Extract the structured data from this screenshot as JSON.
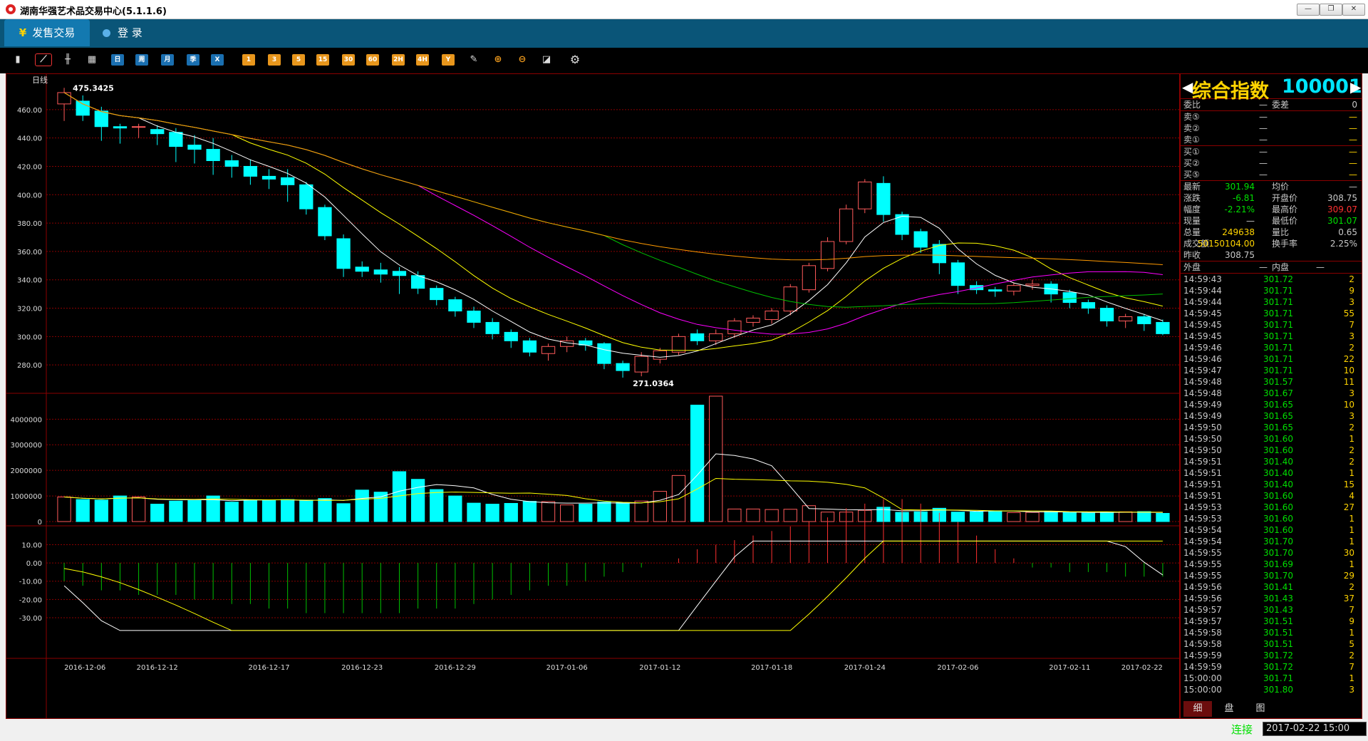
{
  "window": {
    "title": "湖南华强艺术品交易中心(5.1.1.6)",
    "buttons": {
      "minimize": "—",
      "restore": "❐",
      "close": "✕"
    }
  },
  "menu": {
    "sale_trading": "发售交易",
    "login": "登 录"
  },
  "toolbar": {
    "icons": [
      "bar-chart-icon",
      "line-chart-icon",
      "candle-chart-icon",
      "calendar-icon"
    ],
    "periods": [
      "日",
      "周",
      "月",
      "季",
      "X"
    ],
    "minutes": [
      "1",
      "3",
      "5",
      "15",
      "30",
      "60",
      "2H",
      "4H",
      "Y"
    ],
    "tools": [
      "cross-icon",
      "zoom-in-icon",
      "zoom-out-icon",
      "draw-icon",
      "settings-icon"
    ]
  },
  "chart": {
    "period_label": "日线",
    "max_label": "475.3425",
    "min_label": "271.0364"
  },
  "chart_data": {
    "type": "candlestick",
    "price_axis": {
      "ticks": [
        "460.00",
        "440.00",
        "420.00",
        "400.00",
        "380.00",
        "360.00",
        "340.00",
        "320.00",
        "300.00",
        "280.00"
      ],
      "ylim": [
        262,
        478
      ]
    },
    "volume_axis": {
      "ticks": [
        "4000000",
        "3000000",
        "2000000",
        "1000000",
        "0"
      ],
      "ylim": [
        0,
        4900000
      ]
    },
    "macd_axis": {
      "ticks": [
        "10.00",
        "0.00",
        "-10.00",
        "-20.00",
        "-30.00"
      ],
      "ylim": [
        -39,
        18
      ]
    },
    "dates": [
      "2016-12-06",
      "2016-12-12",
      "2016-12-17",
      "2016-12-23",
      "2016-12-29",
      "2017-01-06",
      "2017-01-12",
      "2017-01-18",
      "2017-01-24",
      "2017-02-06",
      "2017-02-11",
      "2017-02-22"
    ],
    "candles": [
      [
        464,
        472,
        452,
        475.34
      ],
      [
        466,
        456,
        452,
        470
      ],
      [
        459,
        448,
        438,
        462
      ],
      [
        448,
        447,
        436,
        450
      ],
      [
        448,
        448,
        440,
        450
      ],
      [
        446,
        443,
        435,
        449
      ],
      [
        444,
        434,
        423,
        447
      ],
      [
        435,
        432,
        422,
        442
      ],
      [
        432,
        424,
        414,
        440
      ],
      [
        424,
        420,
        412,
        428
      ],
      [
        420,
        413,
        407,
        425
      ],
      [
        413,
        411,
        404,
        418
      ],
      [
        412,
        407,
        395,
        418
      ],
      [
        407,
        390,
        386,
        409
      ],
      [
        391,
        371,
        368,
        393
      ],
      [
        369,
        348,
        342,
        372
      ],
      [
        349,
        346,
        342,
        353
      ],
      [
        347,
        344,
        338,
        352
      ],
      [
        346,
        343,
        330,
        349
      ],
      [
        343,
        334,
        330,
        346
      ],
      [
        334,
        326,
        322,
        336
      ],
      [
        326,
        318,
        314,
        328
      ],
      [
        318,
        310,
        306,
        321
      ],
      [
        310,
        302,
        298,
        313
      ],
      [
        303,
        297,
        292,
        305
      ],
      [
        297,
        289,
        286,
        299
      ],
      [
        288,
        293,
        283,
        295
      ],
      [
        293,
        297,
        289,
        300
      ],
      [
        297,
        294,
        290,
        299
      ],
      [
        295,
        281,
        277,
        296
      ],
      [
        281,
        276,
        271.04,
        283
      ],
      [
        275,
        286,
        272,
        289
      ],
      [
        284,
        290,
        281,
        292
      ],
      [
        289,
        300,
        287,
        302
      ],
      [
        302,
        297,
        294,
        305
      ],
      [
        297,
        302,
        294,
        305
      ],
      [
        302,
        311,
        299,
        313
      ],
      [
        310,
        313,
        307,
        315
      ],
      [
        312,
        318,
        309,
        320
      ],
      [
        318,
        335,
        315,
        337
      ],
      [
        333,
        350,
        331,
        352
      ],
      [
        348,
        367,
        346,
        370
      ],
      [
        367,
        390,
        365,
        393
      ],
      [
        390,
        409,
        387,
        411
      ],
      [
        408,
        386,
        381,
        413
      ],
      [
        386,
        372,
        368,
        388
      ],
      [
        374,
        363,
        359,
        376
      ],
      [
        365,
        352,
        344,
        368
      ],
      [
        352,
        336,
        330,
        354
      ],
      [
        336,
        333,
        330,
        339
      ],
      [
        333,
        332,
        328,
        335
      ],
      [
        332,
        336,
        329,
        338
      ],
      [
        336,
        337,
        333,
        340
      ],
      [
        337,
        330,
        324,
        339
      ],
      [
        331,
        324,
        320,
        333
      ],
      [
        324,
        320,
        316,
        326
      ],
      [
        320,
        311,
        307,
        322
      ],
      [
        311,
        314,
        306,
        316
      ],
      [
        314,
        309,
        304,
        316
      ],
      [
        310,
        302,
        301,
        312
      ]
    ],
    "volume": [
      960000,
      860000,
      840000,
      1000000,
      960000,
      680000,
      800000,
      820000,
      1000000,
      760000,
      820000,
      820000,
      860000,
      840000,
      900000,
      700000,
      1230000,
      1150000,
      1950000,
      1650000,
      1250000,
      1000000,
      720000,
      680000,
      710000,
      790000,
      780000,
      650000,
      680000,
      760000,
      740000,
      800000,
      1180000,
      1800000,
      4550000,
      4900000,
      490000,
      490000,
      470000,
      480000,
      620000,
      370000,
      370000,
      440000,
      560000,
      360000,
      380000,
      520000,
      370000,
      380000,
      420000,
      350000,
      360000,
      390000,
      350000,
      330000,
      360000,
      380000,
      390000,
      320000
    ],
    "macd_hist": [
      -4,
      -5,
      -6,
      -6,
      -7,
      -7,
      -7,
      -8,
      -8,
      -9,
      -9,
      -10,
      -10,
      -11,
      -11,
      -11,
      -11,
      -11,
      -11,
      -10,
      -10,
      -10,
      -9,
      -8,
      -7,
      -6,
      -5,
      -5,
      -4,
      -3,
      -2,
      -1,
      0,
      1,
      3,
      4,
      5,
      6,
      7,
      8,
      9,
      10,
      12,
      13,
      14,
      14,
      13,
      11,
      9,
      6,
      3,
      1,
      -1,
      -1,
      -2,
      -2,
      -2,
      -3,
      -3,
      -3
    ]
  },
  "quote": {
    "name": "综合指数",
    "code": "100001",
    "weibi_label": "委比",
    "weibi_value": "—",
    "weicha_label": "委差",
    "weicha_value": "0",
    "sells": [
      {
        "label": "卖⑤",
        "price": "—",
        "vol": "—"
      },
      {
        "label": "卖②",
        "price": "—",
        "vol": "—"
      },
      {
        "label": "卖①",
        "price": "—",
        "vol": "—"
      }
    ],
    "buys": [
      {
        "label": "买①",
        "price": "—",
        "vol": "—"
      },
      {
        "label": "买②",
        "price": "—",
        "vol": "—"
      },
      {
        "label": "买⑤",
        "price": "—",
        "vol": "—"
      }
    ],
    "stats": [
      {
        "l1": "最新",
        "v1": "301.94",
        "l2": "均价",
        "v2": "—",
        "c1": "#00e000",
        "c2": "#c8c8c8"
      },
      {
        "l1": "涨跌",
        "v1": "-6.81",
        "l2": "开盘价",
        "v2": "308.75",
        "c1": "#00e000",
        "c2": "#c8c8c8"
      },
      {
        "l1": "幅度",
        "v1": "-2.21%",
        "l2": "最高价",
        "v2": "309.07",
        "c1": "#00e000",
        "c2": "#ff3030"
      },
      {
        "l1": "现量",
        "v1": "—",
        "l2": "最低价",
        "v2": "301.07",
        "c1": "#c8c8c8",
        "c2": "#00e000"
      },
      {
        "l1": "总量",
        "v1": "249638",
        "l2": "量比",
        "v2": "0.65",
        "c1": "#ffd400",
        "c2": "#c8c8c8"
      },
      {
        "l1": "成交额",
        "v1": "50150104.00",
        "l2": "换手率",
        "v2": "2.25%",
        "c1": "#ffd400",
        "c2": "#c8c8c8"
      },
      {
        "l1": "昨收",
        "v1": "308.75",
        "l2": "",
        "v2": "",
        "c1": "#c8c8c8",
        "c2": "#c8c8c8"
      }
    ],
    "waipan_label": "外盘",
    "waipan_value": "—",
    "neipan_label": "内盘",
    "neipan_value": "—",
    "ticks": [
      [
        "14:59:43",
        "301.72",
        "2"
      ],
      [
        "14:59:44",
        "301.71",
        "9"
      ],
      [
        "14:59:44",
        "301.71",
        "3"
      ],
      [
        "14:59:45",
        "301.71",
        "55"
      ],
      [
        "14:59:45",
        "301.71",
        "7"
      ],
      [
        "14:59:45",
        "301.71",
        "3"
      ],
      [
        "14:59:46",
        "301.71",
        "2"
      ],
      [
        "14:59:46",
        "301.71",
        "22"
      ],
      [
        "14:59:47",
        "301.71",
        "10"
      ],
      [
        "14:59:48",
        "301.57",
        "11"
      ],
      [
        "14:59:48",
        "301.67",
        "3"
      ],
      [
        "14:59:49",
        "301.65",
        "10"
      ],
      [
        "14:59:49",
        "301.65",
        "3"
      ],
      [
        "14:59:50",
        "301.65",
        "2"
      ],
      [
        "14:59:50",
        "301.60",
        "1"
      ],
      [
        "14:59:50",
        "301.60",
        "2"
      ],
      [
        "14:59:51",
        "301.40",
        "2"
      ],
      [
        "14:59:51",
        "301.40",
        "1"
      ],
      [
        "14:59:51",
        "301.40",
        "15"
      ],
      [
        "14:59:51",
        "301.60",
        "4"
      ],
      [
        "14:59:53",
        "301.60",
        "27"
      ],
      [
        "14:59:53",
        "301.60",
        "1"
      ],
      [
        "14:59:54",
        "301.60",
        "1"
      ],
      [
        "14:59:54",
        "301.70",
        "1"
      ],
      [
        "14:59:55",
        "301.70",
        "30"
      ],
      [
        "14:59:55",
        "301.69",
        "1"
      ],
      [
        "14:59:55",
        "301.70",
        "29"
      ],
      [
        "14:59:56",
        "301.41",
        "2"
      ],
      [
        "14:59:56",
        "301.43",
        "37"
      ],
      [
        "14:59:57",
        "301.43",
        "7"
      ],
      [
        "14:59:57",
        "301.51",
        "9"
      ],
      [
        "14:59:58",
        "301.51",
        "1"
      ],
      [
        "14:59:58",
        "301.51",
        "5"
      ],
      [
        "14:59:59",
        "301.72",
        "2"
      ],
      [
        "14:59:59",
        "301.72",
        "7"
      ],
      [
        "15:00:00",
        "301.71",
        "1"
      ],
      [
        "15:00:00",
        "301.80",
        "3"
      ]
    ],
    "tabs": [
      "细",
      "盘",
      "图"
    ]
  },
  "status": {
    "connection": "连接",
    "datetime": "2017-02-22 15:00"
  }
}
